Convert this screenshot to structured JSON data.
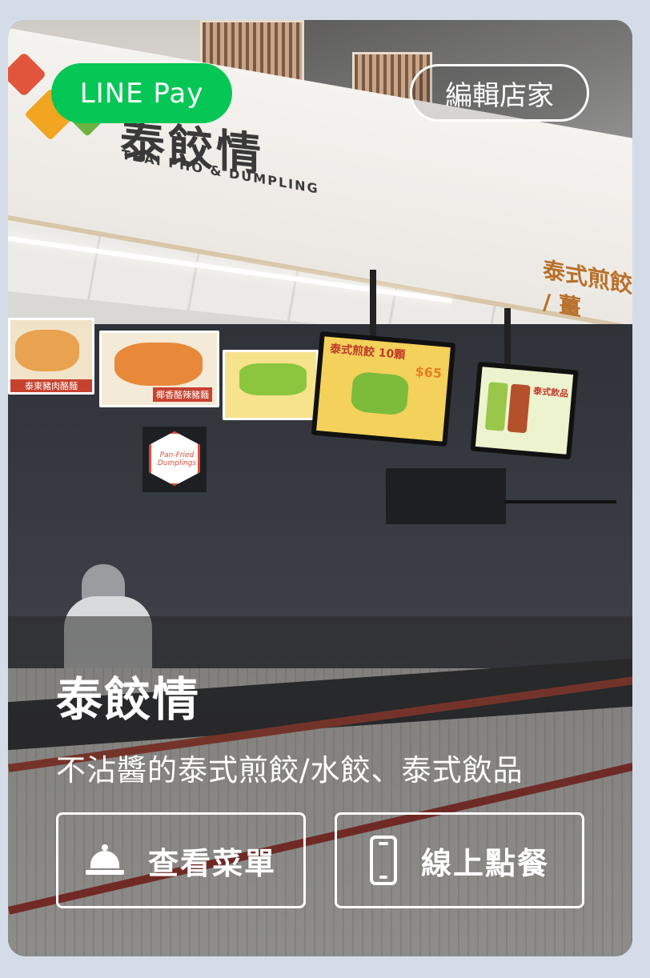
{
  "badges": {
    "payment": "LINE Pay",
    "edit": "編輯店家"
  },
  "store": {
    "name": "泰餃情",
    "description": "不沾醬的泰式煎餃/水餃、泰式飲品"
  },
  "photo": {
    "sign_title": "泰餃情",
    "sign_subtitle": "THAI PHO & DUMPLING",
    "sign_side": "泰式煎餃 / 薑",
    "menu_labels": [
      "泰東豬肉酪麵",
      "椰香酪辣豬麵",
      "泰式煎餃 10顆",
      "泰式飲品"
    ],
    "price_tag": "$65",
    "hex_sign": "Pan-Fried Dumplings"
  },
  "actions": {
    "menu": {
      "label": "查看菜單",
      "icon": "bell-icon"
    },
    "order": {
      "label": "線上點餐",
      "icon": "phone-icon"
    }
  },
  "colors": {
    "line_green": "#06c755",
    "page_bg": "#d4dde7"
  }
}
